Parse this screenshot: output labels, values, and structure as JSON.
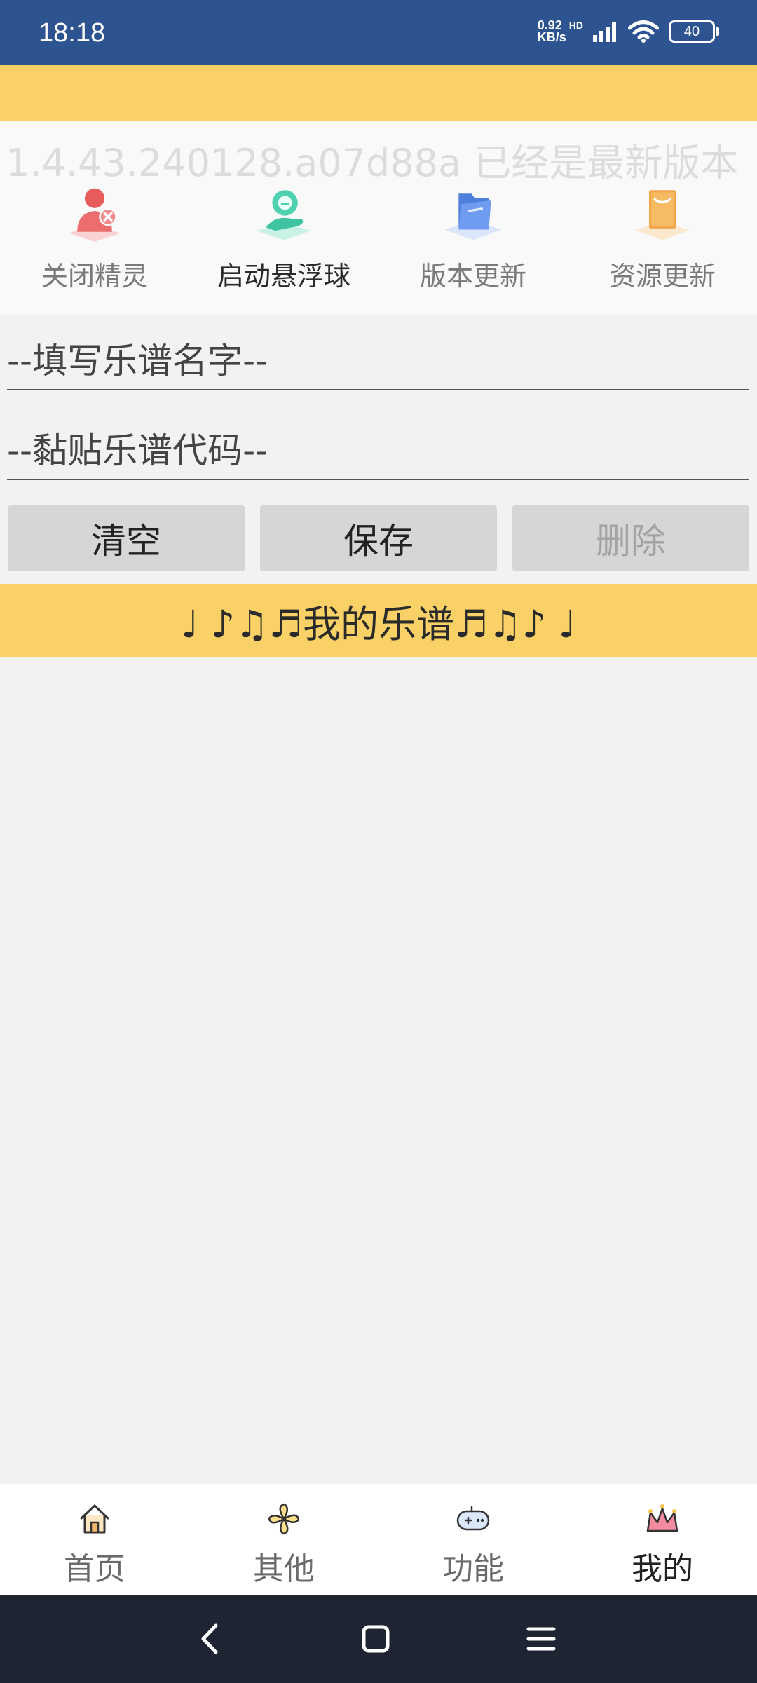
{
  "status_bar": {
    "time": "18:18",
    "net_speed_value": "0.92",
    "net_speed_unit": "KB/s",
    "hd": "HD",
    "battery": "40"
  },
  "panel": {
    "version_text": "1.4.43.240128.a07d88a 已经是最新版本",
    "actions": [
      {
        "label": "关闭精灵",
        "icon": "close-sprite-icon"
      },
      {
        "label": "启动悬浮球",
        "icon": "floating-ball-icon"
      },
      {
        "label": "版本更新",
        "icon": "version-update-icon"
      },
      {
        "label": "资源更新",
        "icon": "resource-update-icon"
      }
    ]
  },
  "form": {
    "name_placeholder": "--填写乐谱名字--",
    "code_placeholder": "--黏贴乐谱代码--",
    "clear_label": "清空",
    "save_label": "保存",
    "delete_label": "删除"
  },
  "scores_banner": "♩ ♪♫♬我的乐谱♬♫♪ ♩",
  "bottom_nav": [
    {
      "label": "首页",
      "icon": "home-icon"
    },
    {
      "label": "其他",
      "icon": "pinwheel-icon"
    },
    {
      "label": "功能",
      "icon": "gamepad-icon"
    },
    {
      "label": "我的",
      "icon": "crown-icon"
    }
  ],
  "colors": {
    "status_bar": "#2d5490",
    "accent_yellow": "#f9d166",
    "button_gray": "#d6d6d6",
    "system_nav": "#1f2433"
  }
}
